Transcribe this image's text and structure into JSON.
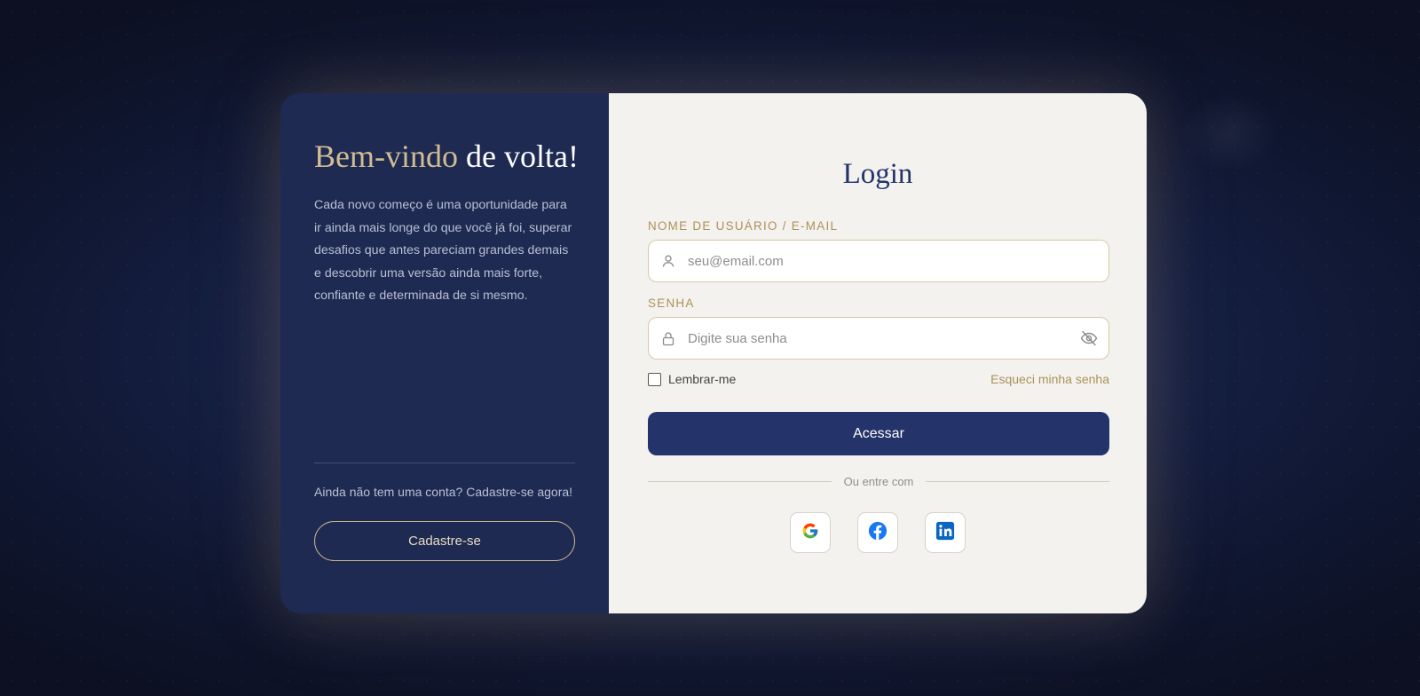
{
  "left_panel": {
    "title_gold": "Bem-vindo",
    "title_white": "de volta!",
    "intro": "Cada novo começo é uma oportunidade para ir ainda mais longe do que você já foi, superar desafios que antes pareciam grandes demais e descobrir uma versão ainda mais forte, confiante e determinada de si mesmo.",
    "signup_prompt": "Ainda não tem uma conta? Cadastre-se agora!",
    "signup_button": "Cadastre-se"
  },
  "login_form": {
    "title": "Login",
    "username_label": "NOME DE USUÁRIO / E-MAIL",
    "username_placeholder": "seu@email.com",
    "username_value": "",
    "password_label": "SENHA",
    "password_placeholder": "Digite sua senha",
    "password_value": "",
    "remember_label": "Lembrar-me",
    "remember_checked": false,
    "forgot_link": "Esqueci minha senha",
    "submit_label": "Acessar",
    "social_divider": "Ou entre com",
    "social_providers": [
      "google-icon",
      "facebook-icon",
      "linkedin-icon"
    ]
  },
  "colors": {
    "navy": "#1e2a52",
    "button_navy": "#24336a",
    "gold": "#ab9159",
    "light_gold": "#d2bc92",
    "form_bg": "#f4f2ee"
  }
}
